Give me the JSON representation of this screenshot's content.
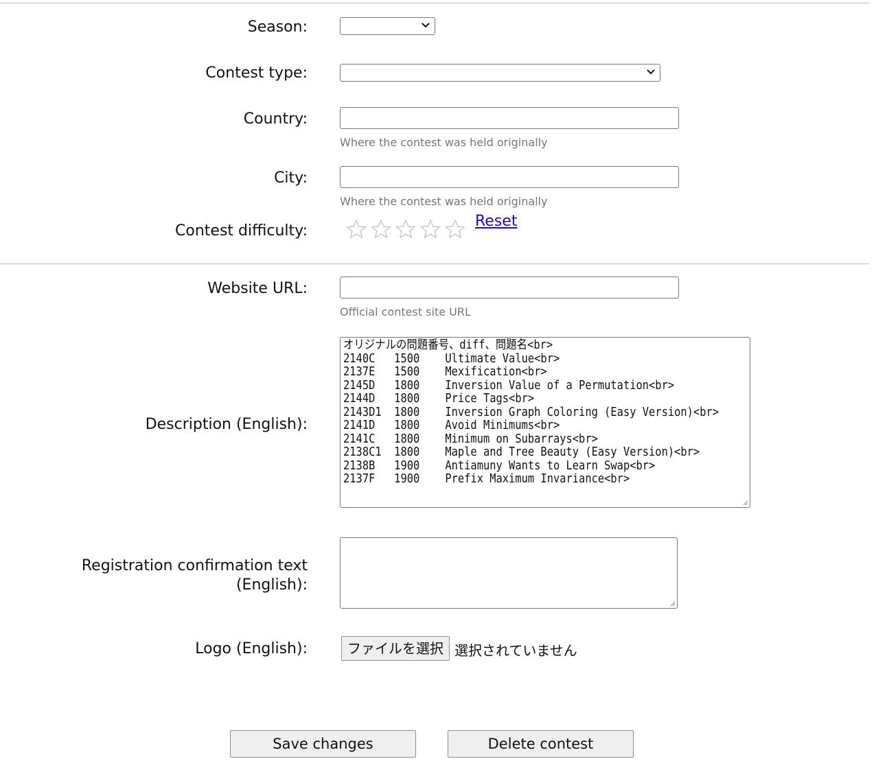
{
  "form": {
    "season_label": "Season:",
    "contest_type_label": "Contest type:",
    "country_label": "Country:",
    "country_hint": "Where the contest was held originally",
    "city_label": "City:",
    "city_hint": "Where the contest was held originally",
    "difficulty_label": "Contest difficulty:",
    "difficulty_stars": 0,
    "difficulty_max": 5,
    "reset_link": "Reset",
    "website_label": "Website URL:",
    "website_hint": "Official contest site URL",
    "description_label": "Description (English):",
    "description_value": "オリジナルの問題番号、diff、問題名<br>\n2140C   1500    Ultimate Value<br>\n2137E   1500    Mexification<br>\n2145D   1800    Inversion Value of a Permutation<br>\n2144D   1800    Price Tags<br>\n2143D1  1800    Inversion Graph Coloring (Easy Version)<br>\n2141D   1800    Avoid Minimums<br>\n2141C   1800    Minimum on Subarrays<br>\n2138C1  1800    Maple and Tree Beauty (Easy Version)<br>\n2138B   1900    Antiamuny Wants to Learn Swap<br>\n2137F   1900    Prefix Maximum Invariance<br>",
    "registration_label_line1": "Registration confirmation text",
    "registration_label_line2": "(English):",
    "logo_label": "Logo (English):",
    "file_button": "ファイルを選択",
    "file_status": "選択されていません"
  },
  "actions": {
    "save_label": "Save changes",
    "delete_label": "Delete contest"
  },
  "icons": {
    "star": "star-outline-icon",
    "dropdown": "chevron-down-icon",
    "resize": "resize-grip-icon"
  },
  "colors": {
    "link": "#1a0dab",
    "hint": "#767676",
    "border": "#767676",
    "star_outline": "#c8c8c8"
  }
}
